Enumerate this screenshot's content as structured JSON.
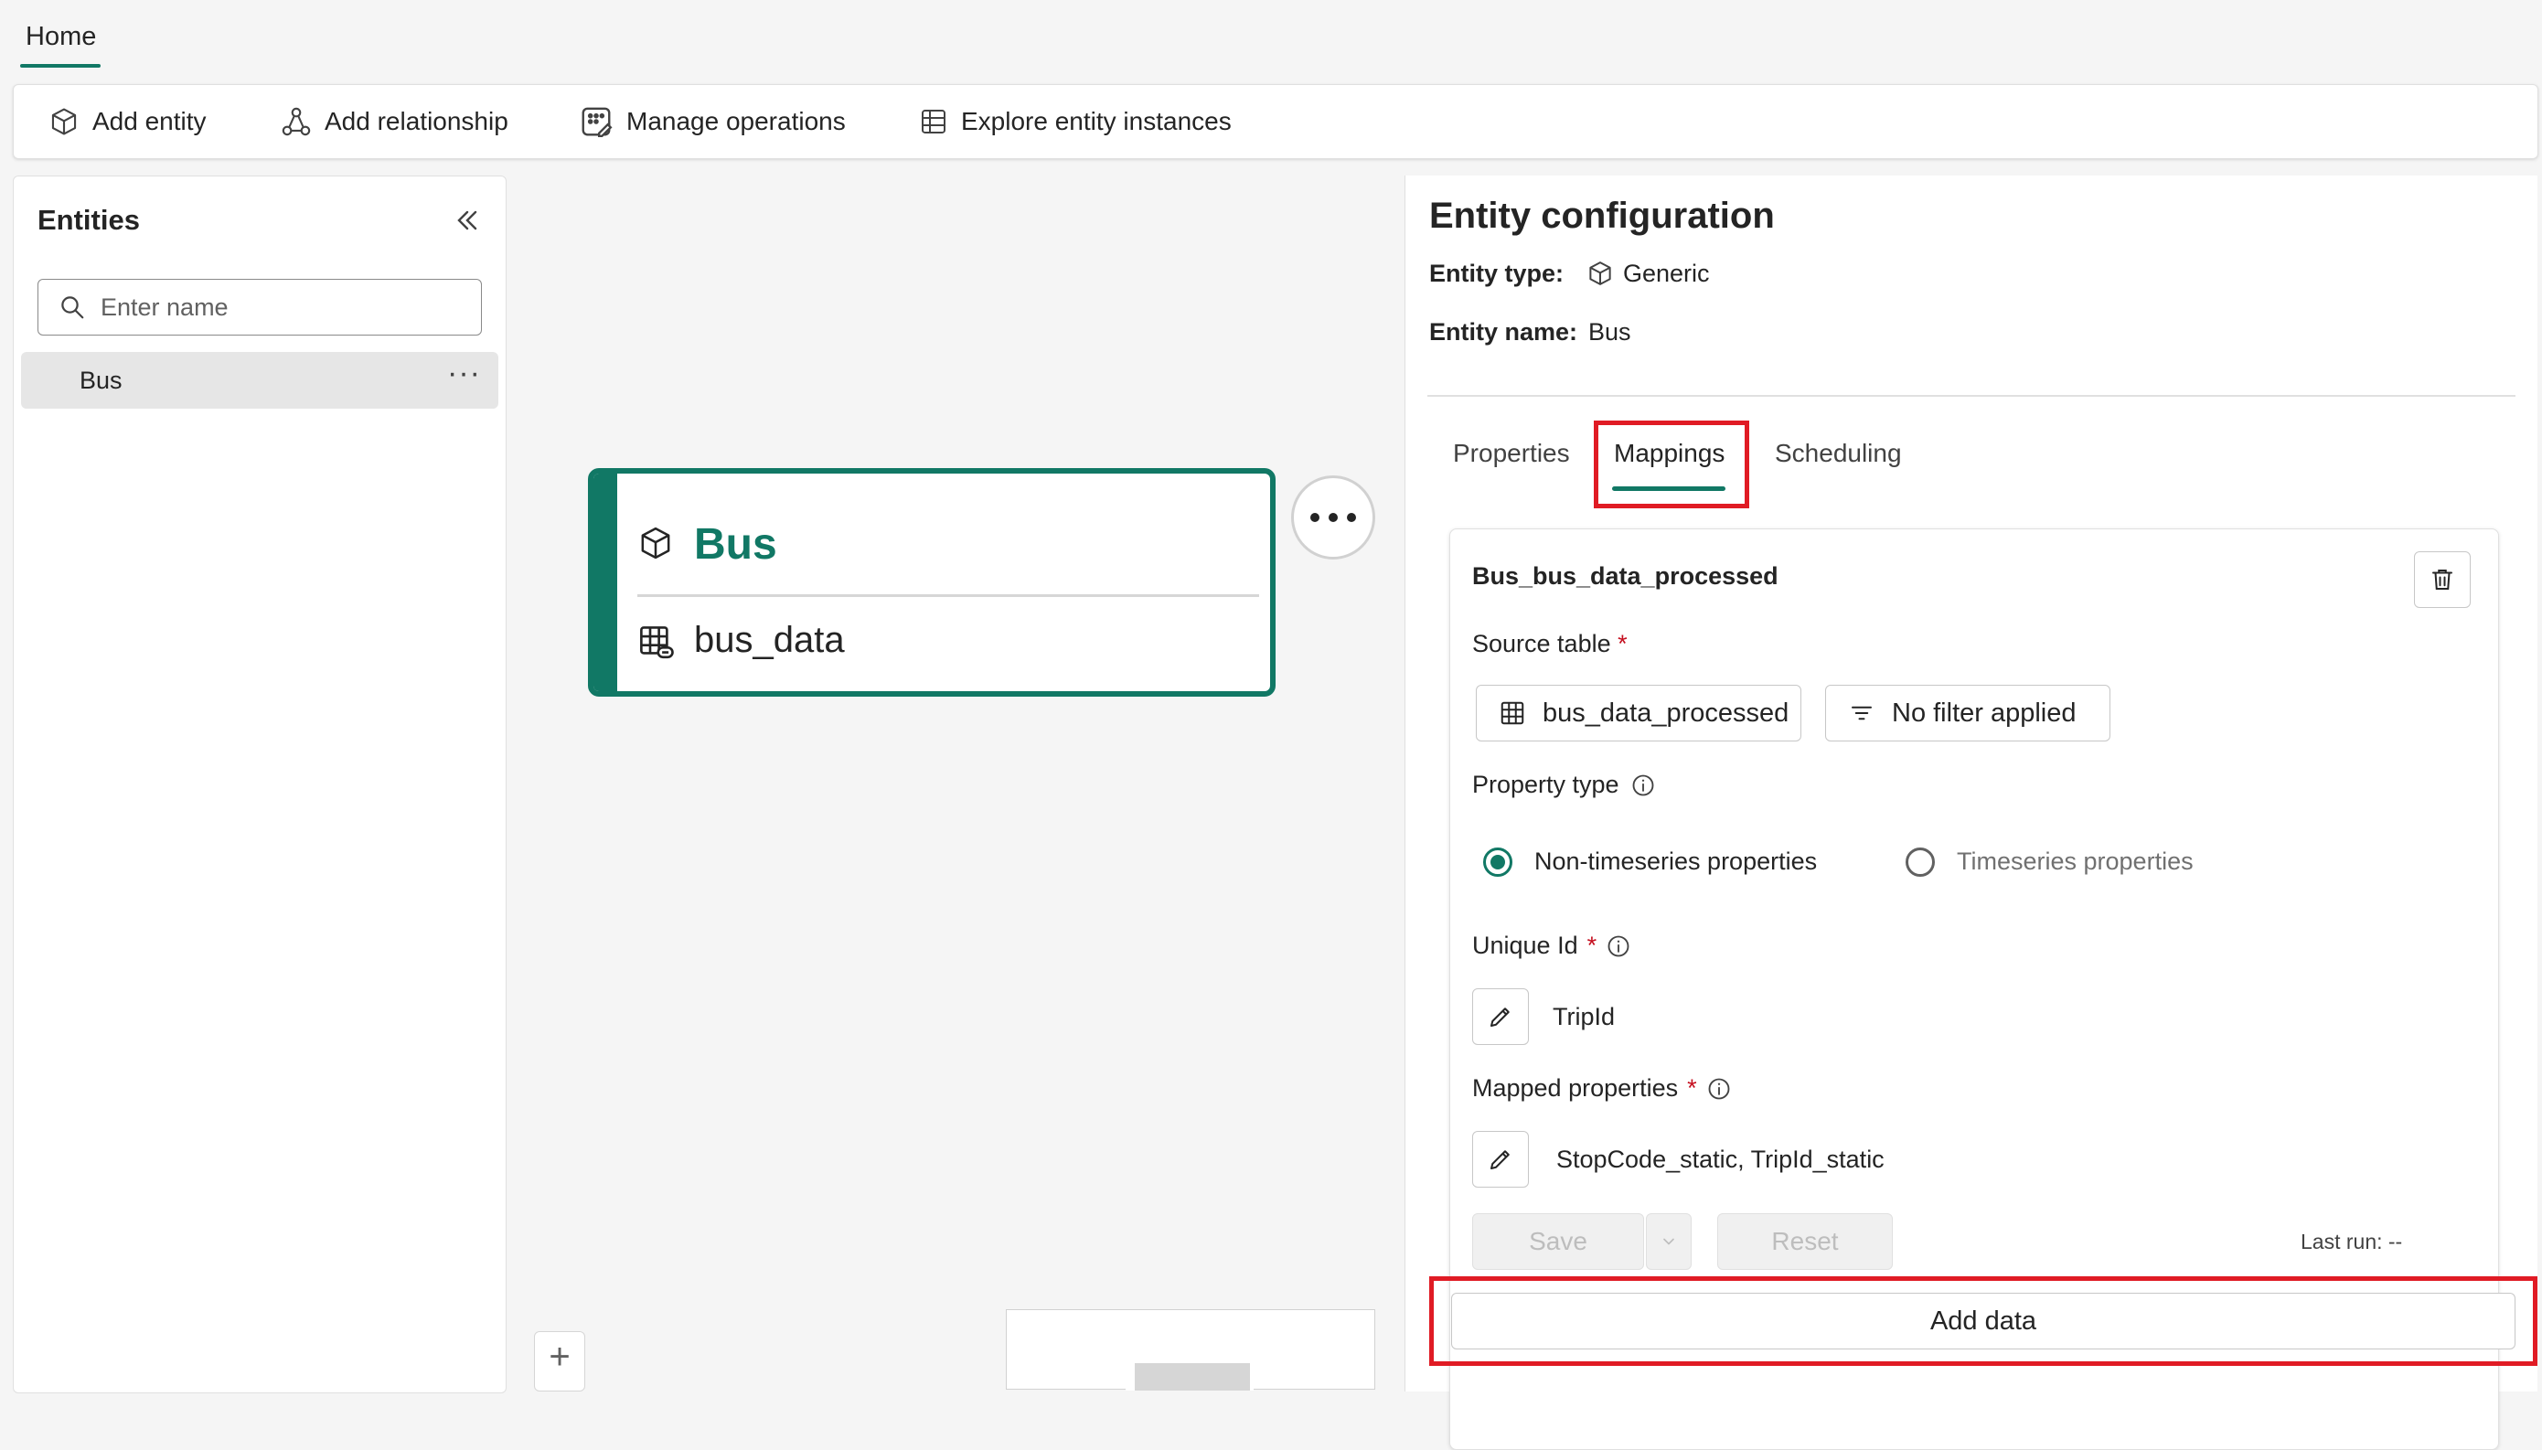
{
  "top_tab": {
    "label": "Home"
  },
  "ribbon": {
    "add_entity": "Add entity",
    "add_relationship": "Add relationship",
    "manage_operations": "Manage operations",
    "explore_entity_instances": "Explore entity instances"
  },
  "entities_panel": {
    "title": "Entities",
    "search_placeholder": "Enter name",
    "items": [
      {
        "label": "Bus",
        "more": "···"
      }
    ]
  },
  "canvas": {
    "node": {
      "title": "Bus",
      "source": "bus_data"
    },
    "zoom_in": "+"
  },
  "config": {
    "title": "Entity configuration",
    "entity_type_label": "Entity type:",
    "entity_type_value": "Generic",
    "entity_name_label": "Entity name:",
    "entity_name_value": "Bus",
    "tabs": [
      "Properties",
      "Mappings",
      "Scheduling"
    ],
    "selected_tab": "Mappings",
    "mapping": {
      "name": "Bus_bus_data_processed",
      "source_table_label": "Source table",
      "source_table_value": "bus_data_processed",
      "filter_label": "No filter applied",
      "property_type_label": "Property type",
      "radio_non_timeseries": "Non-timeseries properties",
      "radio_timeseries": "Timeseries properties",
      "unique_id_label": "Unique Id",
      "unique_id_value": "TripId",
      "mapped_properties_label": "Mapped properties",
      "mapped_properties_value": "StopCode_static, TripId_static",
      "save": "Save",
      "reset": "Reset",
      "last_run": "Last run: --",
      "required_mark": "*"
    },
    "add_data": "Add data"
  },
  "colors": {
    "accent": "#117865",
    "highlight": "#e01b24"
  }
}
